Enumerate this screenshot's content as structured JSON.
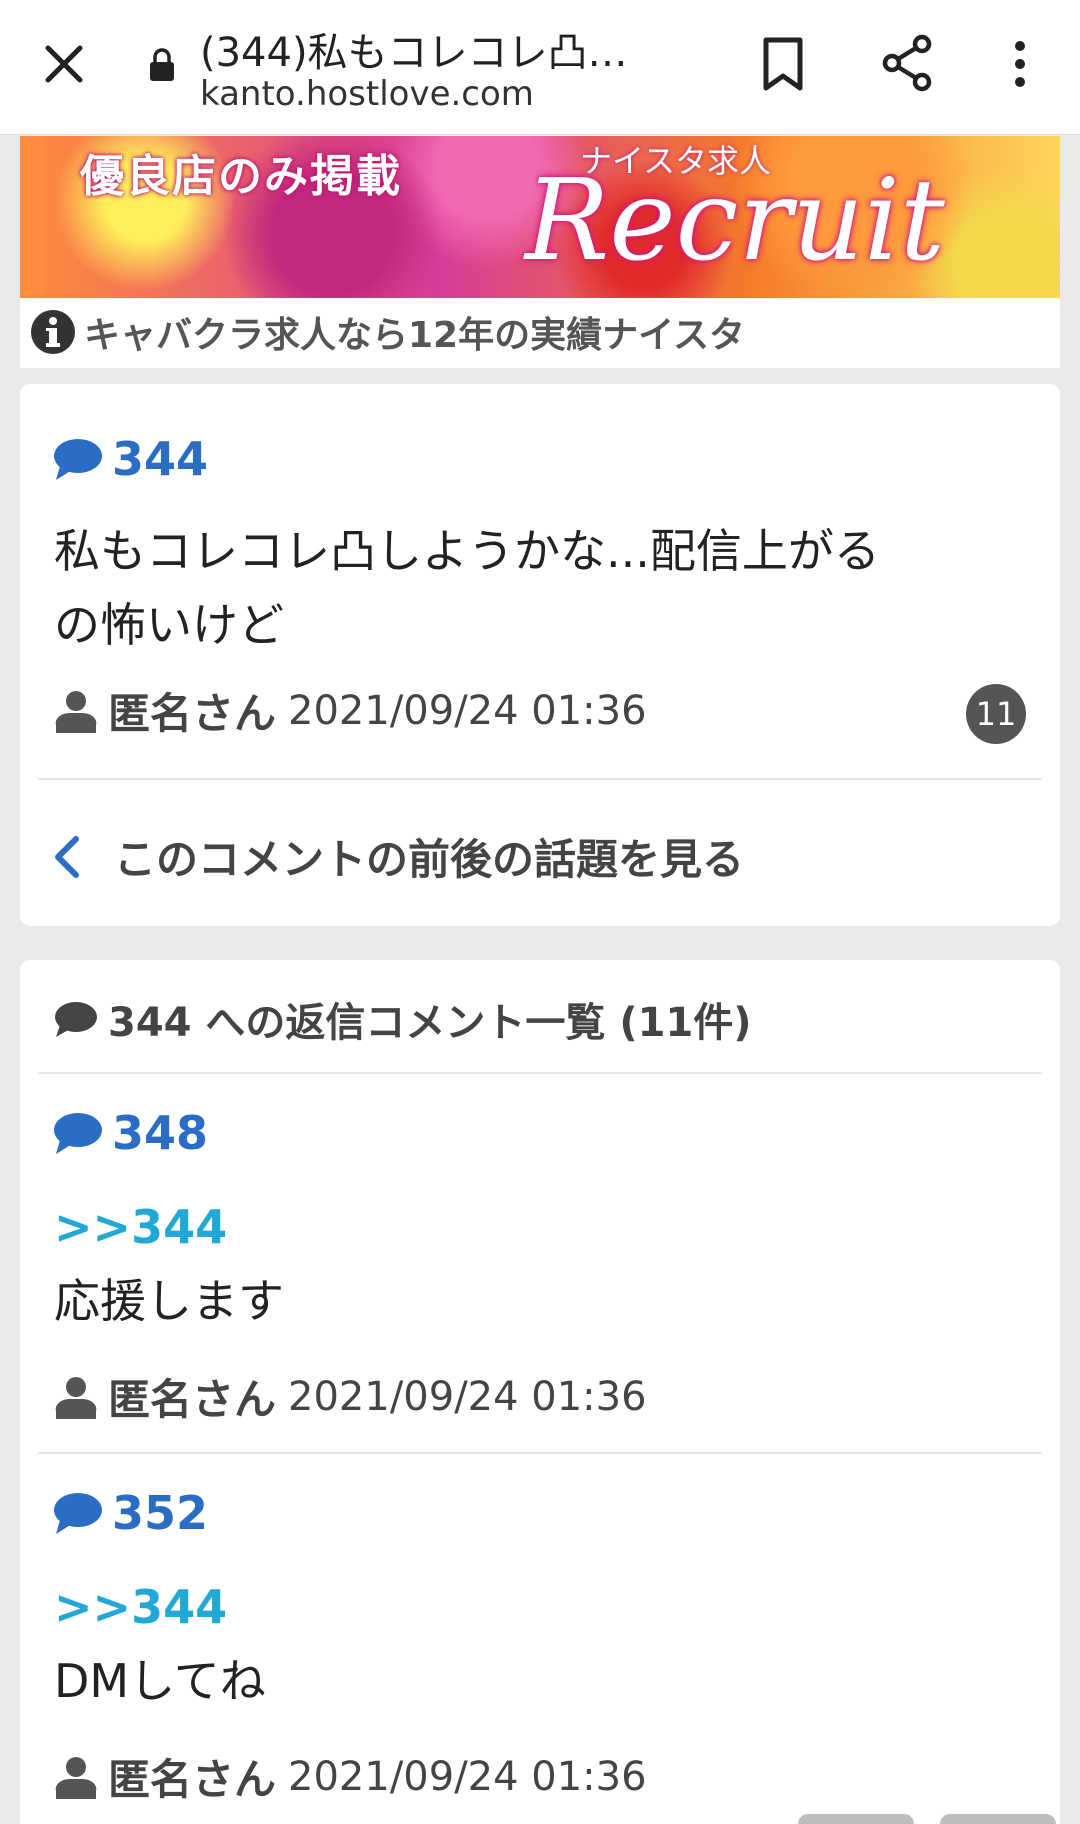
{
  "browser": {
    "title": "(344)私もコレコレ凸…",
    "url": "kanto.hostlove.com"
  },
  "banner": {
    "left_text": "優良店のみ掲載",
    "sub_text": "ナイスタ求人",
    "right_text": "Recruit",
    "info_text": "キャバクラ求人なら12年の実績ナイスタ"
  },
  "post": {
    "number": "344",
    "body_line1": "私もコレコレ凸しようかな...配信上がる",
    "body_line2": "の怖いけど",
    "author": "匿名さん",
    "date": "2021/09/24 01:36",
    "reply_count": "11",
    "prev_link": "このコメントの前後の話題を見る"
  },
  "replies_section": {
    "header": "344 への返信コメント一覧 (11件)",
    "items": [
      {
        "number": "348",
        "reply_to": ">>344",
        "body": "応援します",
        "author": "匿名さん",
        "date": "2021/09/24 01:36"
      },
      {
        "number": "352",
        "reply_to": ">>344",
        "body": "DMしてね",
        "author": "匿名さん",
        "date": "2021/09/24 01:36"
      }
    ]
  },
  "colors": {
    "accent_blue": "#2b6cc4",
    "reply_cyan": "#22a8d6"
  }
}
